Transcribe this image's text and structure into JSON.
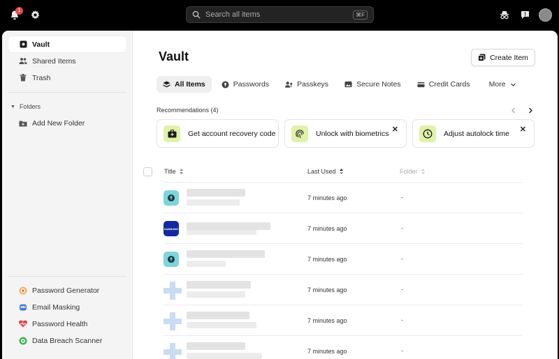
{
  "topbar": {
    "notification_count": "1",
    "search_placeholder": "Search all items",
    "search_shortcut": "⌘F"
  },
  "sidebar": {
    "primary": [
      {
        "label": "Vault",
        "icon": "vault-icon",
        "active": true
      },
      {
        "label": "Shared Items",
        "icon": "users-icon"
      },
      {
        "label": "Trash",
        "icon": "trash-icon"
      }
    ],
    "folders_heading": "Folders",
    "add_folder": "Add New Folder",
    "tools": [
      {
        "label": "Password Generator",
        "icon": "password-generator-icon"
      },
      {
        "label": "Email Masking",
        "icon": "email-masking-icon"
      },
      {
        "label": "Password Health",
        "icon": "password-health-icon"
      },
      {
        "label": "Data Breach Scanner",
        "icon": "data-breach-scanner-icon"
      }
    ]
  },
  "main": {
    "title": "Vault",
    "create_button": "Create Item",
    "tabs": [
      {
        "label": "All Items",
        "active": true
      },
      {
        "label": "Passwords"
      },
      {
        "label": "Passkeys"
      },
      {
        "label": "Secure Notes"
      },
      {
        "label": "Credit Cards"
      },
      {
        "label": "More"
      }
    ],
    "recommendations_label": "Recommendations (4)",
    "recommendations": [
      {
        "label": "Get account recovery code",
        "icon": "recovery-kit-icon"
      },
      {
        "label": "Unlock with biometrics",
        "icon": "fingerprint-icon"
      },
      {
        "label": "Adjust autolock time",
        "icon": "clock-icon"
      }
    ],
    "table": {
      "columns": {
        "title": "Title",
        "last_used": "Last Used",
        "folder": "Folder"
      },
      "rows": [
        {
          "logo": "generic-password-icon",
          "last_used": "7 minutes ago",
          "folder": "-"
        },
        {
          "logo": "samsung-logo",
          "logo_text": "SAMSUNG",
          "last_used": "7 minutes ago",
          "folder": "-"
        },
        {
          "logo": "generic-password-icon",
          "last_used": "7 minutes ago",
          "folder": "-"
        },
        {
          "logo": "pixelated-favicon",
          "last_used": "7 minutes ago",
          "folder": "-"
        },
        {
          "logo": "pixelated-favicon",
          "last_used": "7 minutes ago",
          "folder": "-"
        },
        {
          "logo": "pixelated-favicon",
          "last_used": "7 minutes ago",
          "folder": "-"
        }
      ]
    }
  },
  "colors": {
    "accent_lime": "#dff2a8",
    "password_teal": "#7fd4dc",
    "samsung_blue": "#1428a0",
    "badge_red": "#e5484d"
  }
}
